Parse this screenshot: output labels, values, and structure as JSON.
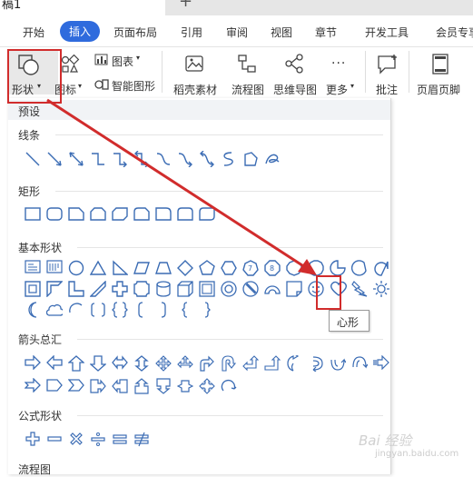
{
  "title_bar": {
    "doc_tab": "稿1",
    "new_tab_symbol": "+"
  },
  "menu": {
    "items": [
      "开始",
      "插入",
      "页面布局",
      "引用",
      "审阅",
      "视图",
      "章节",
      "开发工具",
      "会员专享"
    ],
    "active_index": 1
  },
  "ribbon": {
    "shape_label": "形状",
    "icon_label": "图标",
    "chart_label": "图表",
    "smartart_label": "智能图形",
    "straw_label": "稻壳素材",
    "flowchart_label": "流程图",
    "mindmap_label": "思维导图",
    "more_label": "更多",
    "comment_label": "批注",
    "headerfooter_label": "页眉页脚"
  },
  "panel": {
    "preset_label": "预设",
    "sections": {
      "lines": "线条",
      "rect": "矩形",
      "basic": "基本形状",
      "arrows": "箭头总汇",
      "formula": "公式形状",
      "flow": "流程图"
    }
  },
  "tooltip": {
    "text": "心形"
  },
  "watermark": {
    "text": "Bai 经验",
    "subtext": "jingyan.baidu.com"
  },
  "colors": {
    "accent": "#2f6bdd",
    "shape_stroke": "#3b6cb4",
    "annotation_red": "#d12c2c"
  }
}
